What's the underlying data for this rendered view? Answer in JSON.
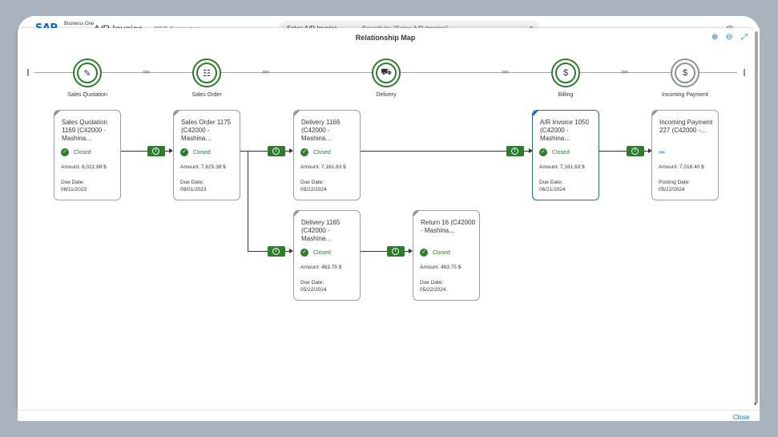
{
  "shell": {
    "logo": "SAP",
    "logo_sub": "Business One",
    "app_title": "A/R Invoice",
    "company": "OEC Computers",
    "search_scope": "Sales A/R Invoice",
    "search_placeholder": "Search In: \"Sales A/R Invoice\"",
    "search_icon": "search-icon",
    "help_icon": "help-icon"
  },
  "dialog": {
    "title": "Relationship Map",
    "tools": [
      "zoom-in-icon",
      "zoom-out-icon",
      "fit-screen-icon"
    ],
    "close_label": "Close"
  },
  "lanes": [
    {
      "label": "Sales Quotation",
      "icon": "quotation-icon",
      "glyph": "✎",
      "status": "done"
    },
    {
      "label": "Sales Order",
      "icon": "clipboard-icon",
      "glyph": "☷",
      "status": "done"
    },
    {
      "label": "Delivery",
      "icon": "truck-icon",
      "glyph": "⛟",
      "status": "done"
    },
    {
      "label": "Billing",
      "icon": "invoice-icon",
      "glyph": "$",
      "status": "done"
    },
    {
      "label": "Incoming Payment",
      "icon": "payment-icon",
      "glyph": "$",
      "status": "pending"
    }
  ],
  "cards": [
    {
      "title": "Sales Quotation 1169 (C42000 - Mashina…",
      "status": "Closed",
      "amount": "Amount: 8,022.88 $",
      "date_label": "Due Date:",
      "date": "08/11/2023"
    },
    {
      "title": "Sales Order 1175 (C42000 - Mashina…",
      "status": "Closed",
      "amount": "Amount: 7,625.38 $",
      "date_label": "Due Date:",
      "date": "09/01/2023"
    },
    {
      "title": "Delivery 1166 (C42000 - Mashina…",
      "status": "Closed",
      "amount": "Amount: 7,161.63 $",
      "date_label": "Due Date:",
      "date": "05/22/2024"
    },
    {
      "title": "A/R Invoice 1050 (C42000 - Mashina…",
      "status": "Closed",
      "amount": "Amount: 7,161.63 $",
      "date_label": "Due Date:",
      "date": "06/21/2024",
      "selected": true
    },
    {
      "title": "Incoming Payment 227 (C42000 -…",
      "status": "",
      "amount": "Amount: 7,018.40 $",
      "date_label": "Posting Date:",
      "date": "05/22/2024"
    },
    {
      "title": "Delivery 1165 (C42000 - Mashina…",
      "status": "Closed",
      "amount": "Amount: 463.75 $",
      "date_label": "Due Date:",
      "date": "05/22/2024"
    },
    {
      "title": "Return 16 (C42000 - Mashina…",
      "status": "Closed",
      "amount": "Amount: 463.75 $",
      "date_label": "Due Date:",
      "date": "05/22/2024"
    }
  ],
  "colors": {
    "closed": "#2b7d2b",
    "accent": "#0a6ed1",
    "pending": "#89919a"
  }
}
